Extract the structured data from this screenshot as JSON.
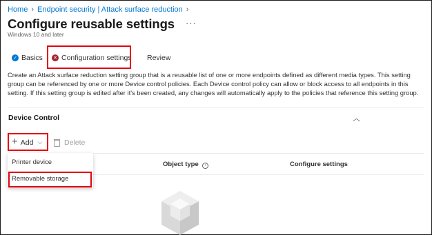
{
  "breadcrumb": {
    "items": [
      "Home",
      "Endpoint security | Attack surface reduction"
    ]
  },
  "header": {
    "title": "Configure reusable settings",
    "more_label": "···",
    "subtitle": "Windows 10 and later"
  },
  "tabs": [
    {
      "label": "Basics",
      "icon": "check-circle-icon",
      "status": "complete"
    },
    {
      "label": "Configuration settings",
      "icon": "error-circle-icon",
      "status": "error",
      "active": true
    },
    {
      "label": "Review",
      "icon": "",
      "status": "pending"
    }
  ],
  "description": "Create an Attack surface reduction setting group that is a reusable list of one or more endpoints defined as different media types. This setting group can be referenced by one or more Device control policies. Each Device control policy can allow or block access to all endpoints in this setting. If this setting group is edited after it's been created, any changes will automatically apply to the policies that reference this setting group.",
  "section": {
    "title": "Device Control",
    "collapse_icon": "chevron-up-icon"
  },
  "toolbar": {
    "add_label": "Add",
    "delete_label": "Delete"
  },
  "table": {
    "columns": [
      "Object type",
      "Configure settings"
    ]
  },
  "add_menu": {
    "items": [
      "Printer device",
      "Removable storage"
    ]
  },
  "colors": {
    "accent": "#0078d4",
    "highlight": "#e3000f",
    "error": "#a4262c"
  }
}
